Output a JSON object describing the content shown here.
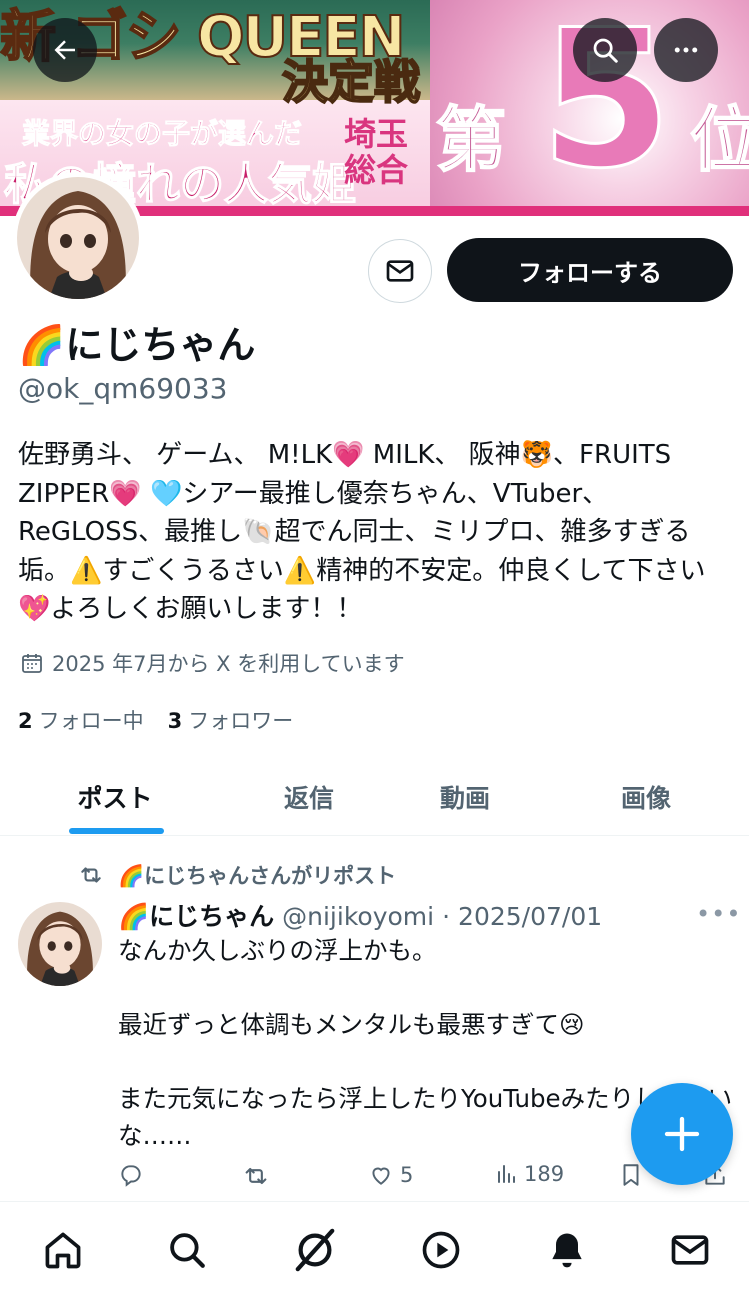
{
  "banner": {
    "line1": "新 ゴシ QUEEN",
    "line2": "決定戦",
    "line3": "業界の女の子が選んだ",
    "line4": "私の憧れの人気姫",
    "line5": "埼玉総合",
    "rank_prefix": "第",
    "rank_number": "5",
    "rank_suffix": "位"
  },
  "profile": {
    "display_name": "🌈にじちゃん",
    "handle": "@ok_qm69033",
    "bio": "佐野勇斗、 ゲーム、 M!LK💗 MILK、 阪神🐯、FRUITS ZIPPER💗 🩵シアー最推し優奈ちゃん、VTuber、ReGLOSS、最推し🐚超でん同士、ミリプロ、雑多すぎる垢。⚠️すごくうるさい⚠️精神的不安定。仲良くして下さい💖よろしくお願いします！！",
    "joined": "2025 年7月から X を利用しています",
    "following_count": "2",
    "following_label": "フォロー中",
    "followers_count": "3",
    "followers_label": "フォロワー",
    "follow_button": "フォローする"
  },
  "tabs": [
    {
      "label": "ポスト"
    },
    {
      "label": "返信"
    },
    {
      "label": "動画"
    },
    {
      "label": "画像"
    }
  ],
  "post": {
    "repost_label": "🌈にじちゃんさんがリポスト",
    "author_name": "🌈にじちゃん",
    "author_handle": "@nijikoyomi",
    "separator": "·",
    "date": "2025/07/01",
    "more": "•••",
    "body": "なんか久しぶりの浮上かも。\n\n最近ずっと体調もメンタルも最悪すぎて😢\n\nまた元気になったら浮上したりYouTubeみたりしみたいな……",
    "reply_count": "",
    "repost_count": "",
    "like_count": "5",
    "view_count": "189"
  },
  "colors": {
    "accent": "#1d9bf0",
    "text": "#0f1419",
    "muted": "#536471"
  },
  "icons": {
    "back": "arrow-left-icon",
    "search": "search-icon",
    "more": "more-icon",
    "mail": "mail-icon",
    "calendar": "calendar-icon",
    "repost": "repost-icon",
    "reply": "reply-icon",
    "like": "heart-icon",
    "views": "views-icon",
    "bookmark": "bookmark-icon",
    "share": "share-icon",
    "compose": "plus-icon",
    "home": "home-icon",
    "explore": "search-icon",
    "grok": "grok-icon",
    "video": "play-icon",
    "notifications": "bell-icon",
    "messages": "mail-icon"
  }
}
